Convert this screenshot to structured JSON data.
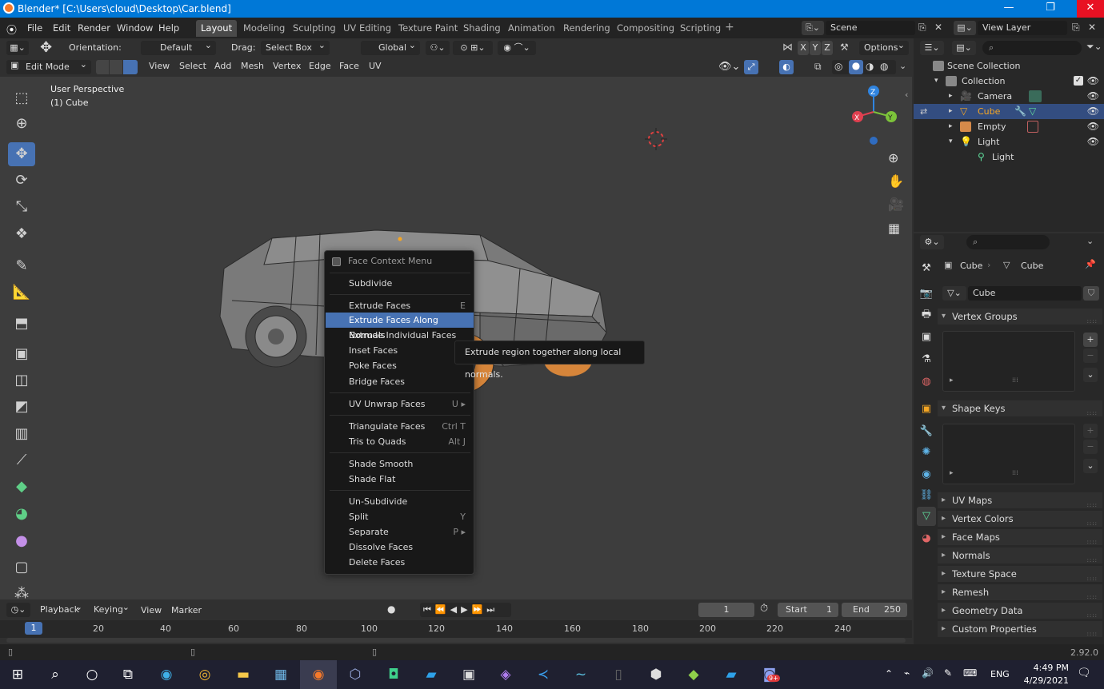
{
  "window": {
    "title": "Blender* [C:\\Users\\cloud\\Desktop\\Car.blend]",
    "minimize": "—",
    "maximize": "❐",
    "close": "✕"
  },
  "menubar": [
    "File",
    "Edit",
    "Render",
    "Window",
    "Help"
  ],
  "workspaces": [
    "Layout",
    "Modeling",
    "Sculpting",
    "UV Editing",
    "Texture Paint",
    "Shading",
    "Animation",
    "Rendering",
    "Compositing",
    "Scripting"
  ],
  "active_workspace": "Layout",
  "scene": {
    "name": "Scene",
    "view_layer": "View Layer"
  },
  "toolheader": {
    "orientation_label": "Orientation:",
    "orientation_value": "Default",
    "drag_label": "Drag:",
    "drag_value": "Select Box",
    "transform_orientation": "Global",
    "axes": [
      "X",
      "Y",
      "Z"
    ],
    "options": "Options"
  },
  "viewheader": {
    "mode": "Edit Mode",
    "menus": [
      "View",
      "Select",
      "Add",
      "Mesh",
      "Vertex",
      "Edge",
      "Face",
      "UV"
    ]
  },
  "viewport": {
    "perspective": "User Perspective",
    "object_info": "(1) Cube",
    "gizmo_axes": [
      "X",
      "Y",
      "Z"
    ]
  },
  "context_menu": {
    "title": "Face Context Menu",
    "items": [
      {
        "label": "Subdivide",
        "shortcut": ""
      },
      {
        "label": "Extrude Faces",
        "shortcut": "E"
      },
      {
        "label": "Extrude Faces Along Normals",
        "shortcut": "",
        "highlighted": true
      },
      {
        "label": "Extrude Individual Faces",
        "shortcut": ""
      },
      {
        "label": "Inset Faces",
        "shortcut": ""
      },
      {
        "label": "Poke Faces",
        "shortcut": ""
      },
      {
        "label": "Bridge Faces",
        "shortcut": ""
      },
      {
        "label": "UV Unwrap Faces",
        "shortcut": "U ▸"
      },
      {
        "label": "Triangulate Faces",
        "shortcut": "Ctrl T"
      },
      {
        "label": "Tris to Quads",
        "shortcut": "Alt J"
      },
      {
        "label": "Shade Smooth",
        "shortcut": ""
      },
      {
        "label": "Shade Flat",
        "shortcut": ""
      },
      {
        "label": "Un-Subdivide",
        "shortcut": ""
      },
      {
        "label": "Split",
        "shortcut": "Y"
      },
      {
        "label": "Separate",
        "shortcut": "P ▸"
      },
      {
        "label": "Dissolve Faces",
        "shortcut": ""
      },
      {
        "label": "Delete Faces",
        "shortcut": ""
      }
    ]
  },
  "tooltip": "Extrude region together along local normals.",
  "outliner": {
    "root": "Scene Collection",
    "collection": "Collection",
    "items": [
      {
        "label": "Camera",
        "selected": false
      },
      {
        "label": "Cube",
        "selected": true
      },
      {
        "label": "Empty",
        "selected": false
      },
      {
        "label": "Light",
        "selected": false
      }
    ],
    "child": "Light"
  },
  "properties": {
    "breadcrumb_object": "Cube",
    "breadcrumb_data": "Cube",
    "mesh_name": "Cube",
    "sections": [
      "Vertex Groups",
      "Shape Keys",
      "UV Maps",
      "Vertex Colors",
      "Face Maps",
      "Normals",
      "Texture Space",
      "Remesh",
      "Geometry Data",
      "Custom Properties"
    ]
  },
  "timeline": {
    "menus": [
      "Playback",
      "Keying",
      "View",
      "Marker"
    ],
    "current_frame": "1",
    "start_label": "Start",
    "start": "1",
    "end_label": "End",
    "end": "250",
    "ruler": [
      "1",
      "20",
      "40",
      "60",
      "80",
      "100",
      "120",
      "140",
      "160",
      "180",
      "200",
      "220",
      "240"
    ]
  },
  "statusbar": {
    "version": "2.92.0"
  },
  "taskbar": {
    "language": "ENG",
    "time": "4:49 PM",
    "date": "4/29/2021",
    "notif_badge": "9+"
  },
  "colors": {
    "accent": "#4772b3",
    "selected_orange": "#f5a623",
    "titlebar": "#0078d7"
  }
}
